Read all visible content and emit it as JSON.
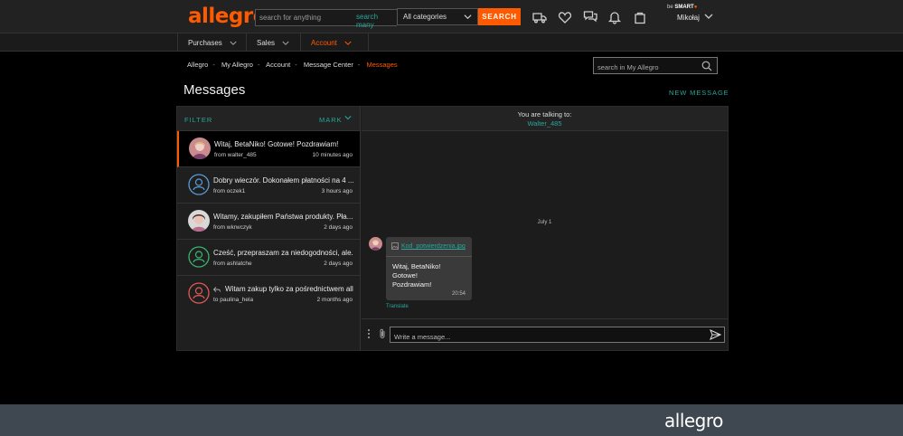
{
  "header": {
    "logo": "allegro",
    "search_placeholder": "search for anything",
    "search_many": "search many",
    "category": "All categories",
    "search_button": "SEARCH",
    "user": {
      "be": "be",
      "smart": "SMART",
      "name": "Mikołaj"
    },
    "icons": [
      "delivery-truck-icon",
      "heart-icon",
      "chat-icon",
      "bell-icon",
      "shopping-bag-icon"
    ]
  },
  "nav": {
    "items": [
      {
        "label": "Purchases",
        "active": false
      },
      {
        "label": "Sales",
        "active": false
      },
      {
        "label": "Account",
        "active": true
      }
    ]
  },
  "breadcrumb": {
    "items": [
      "Allegro",
      "My Allegro",
      "Account",
      "Message Center"
    ],
    "current": "Messages"
  },
  "subsearch_placeholder": "search in My Allegro",
  "page_title": "Messages",
  "new_message": "NEW MESSAGE",
  "list": {
    "filter": "FILTER",
    "mark": "MARK",
    "conversations": [
      {
        "subject": "Witaj, BetaNiko! Gotowe! Pozdrawiam!",
        "from": "from walter_485",
        "when": "10 minutes ago",
        "avatar": "photo",
        "active": true
      },
      {
        "subject": "Dobry wieczór. Dokonałem płatności na 4 ...",
        "from": "from oczek1",
        "when": "3 hours ago",
        "avatar": "outline-blue"
      },
      {
        "subject": "Witamy, zakupiłem Państwa produkty. Pła...",
        "from": "from wkrwczyk",
        "when": "2 days ago",
        "avatar": "photo2"
      },
      {
        "subject": "Cześć, przepraszam za niedogodności, ale...",
        "from": "from ashlatche",
        "when": "2 days ago",
        "avatar": "outline-green"
      },
      {
        "subject": "Witam zakup tylko za pośrednictwem alle...",
        "from": "to paulina_hela",
        "when": "2 months ago",
        "avatar": "outline-red",
        "reply": true
      }
    ]
  },
  "chat": {
    "talking_label": "You are talking to:",
    "talking_user": "Walter_485",
    "date": "July 1",
    "attachment": "Kod_potwierdzenia.jpg",
    "message_lines": [
      "Witaj, BetaNiko!",
      "Gotowe!",
      "Pozdrawiam!"
    ],
    "time": "20:54",
    "translate": "Translate",
    "compose_placeholder": "Write a message..."
  },
  "footer": {
    "logo": "allegro"
  },
  "colors": {
    "accent": "#ff5a00",
    "teal": "#28a69a",
    "footer": "#3f4850"
  }
}
